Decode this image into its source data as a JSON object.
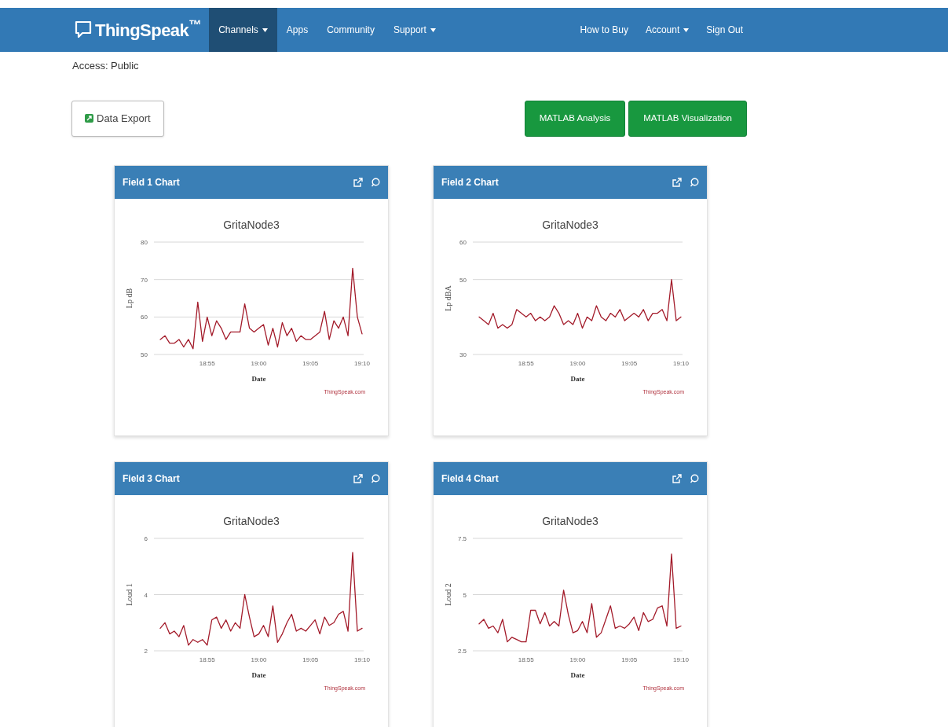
{
  "navbar": {
    "logo": "ThingSpeak$^{™}$",
    "left_items": [
      {
        "label": "Channels",
        "dropdown": true,
        "selected": true
      },
      {
        "label": "Apps",
        "dropdown": false,
        "selected": false
      },
      {
        "label": "Community",
        "dropdown": false,
        "selected": false
      },
      {
        "label": "Support",
        "dropdown": true,
        "selected": false
      }
    ],
    "right_items": [
      {
        "label": "How to Buy",
        "dropdown": false
      },
      {
        "label": "Account",
        "dropdown": true
      },
      {
        "label": "Sign Out",
        "dropdown": false
      }
    ]
  },
  "access": "Access: Public",
  "export_button": "Data Export",
  "matlab_buttons": [
    "MATLAB Analysis",
    "MATLAB Visualization"
  ],
  "charts": [
    {
      "header": "Field 1 Chart",
      "credit": "ThingSpeak.com",
      "chart_data": {
        "type": "line",
        "title": "GritaNode3",
        "xlabel": "Date",
        "ylabel": "Lp dB",
        "ylim": [
          50,
          80
        ],
        "yticks": [
          50,
          60,
          70,
          80
        ],
        "categories": [
          null,
          null,
          null,
          null,
          null,
          null,
          null,
          null,
          null,
          null,
          "18:55",
          null,
          null,
          null,
          null,
          null,
          null,
          null,
          null,
          null,
          null,
          "19:00",
          null,
          null,
          null,
          null,
          null,
          null,
          null,
          null,
          null,
          null,
          "19:05",
          null,
          null,
          null,
          null,
          null,
          null,
          null,
          null,
          null,
          null,
          "19:10"
        ],
        "series": [
          {
            "color": "#a31b2a",
            "values": [
              54,
              55,
              53,
              53,
              54,
              52,
              54,
              51.5,
              64,
              53.5,
              60,
              55,
              59,
              57,
              54,
              56,
              56,
              56,
              63.5,
              57,
              56,
              57,
              58,
              52.5,
              57,
              52,
              58.5,
              55,
              57,
              53.5,
              55,
              54,
              54,
              55,
              56,
              61.5,
              54,
              59,
              57,
              60,
              55,
              73,
              60,
              55.5
            ]
          }
        ]
      }
    },
    {
      "header": "Field 2 Chart",
      "credit": "ThingSpeak.com",
      "chart_data": {
        "type": "line",
        "title": "GritaNode3",
        "xlabel": "Date",
        "ylabel": "Lp dBA",
        "ylim": [
          30,
          60
        ],
        "yticks": [
          30,
          50,
          60
        ],
        "categories": [
          null,
          null,
          null,
          null,
          null,
          null,
          null,
          null,
          null,
          null,
          "18:55",
          null,
          null,
          null,
          null,
          null,
          null,
          null,
          null,
          null,
          null,
          "19:00",
          null,
          null,
          null,
          null,
          null,
          null,
          null,
          null,
          null,
          null,
          "19:05",
          null,
          null,
          null,
          null,
          null,
          null,
          null,
          null,
          null,
          null,
          "19:10"
        ],
        "series": [
          {
            "color": "#a31b2a",
            "values": [
              40,
              39,
              38,
              41,
              37,
              38,
              37,
              38,
              42,
              41,
              40,
              41,
              39,
              40,
              39,
              40,
              43,
              41,
              38,
              39,
              38,
              41,
              37,
              40,
              39,
              43,
              40,
              39,
              41,
              40,
              42,
              39,
              40,
              41,
              40,
              42,
              39,
              41,
              41,
              42,
              39,
              50,
              39,
              40
            ]
          }
        ]
      }
    },
    {
      "header": "Field 3 Chart",
      "credit": "ThingSpeak.com",
      "chart_data": {
        "type": "line",
        "title": "GritaNode3",
        "xlabel": "Date",
        "ylabel": "Loud 1",
        "ylim": [
          2,
          6
        ],
        "yticks": [
          2,
          4,
          6
        ],
        "categories": [
          null,
          null,
          null,
          null,
          null,
          null,
          null,
          null,
          null,
          null,
          "18:55",
          null,
          null,
          null,
          null,
          null,
          null,
          null,
          null,
          null,
          null,
          "19:00",
          null,
          null,
          null,
          null,
          null,
          null,
          null,
          null,
          null,
          null,
          "19:05",
          null,
          null,
          null,
          null,
          null,
          null,
          null,
          null,
          null,
          null,
          "19:10"
        ],
        "series": [
          {
            "color": "#a31b2a",
            "values": [
              2.8,
              3.0,
              2.6,
              2.7,
              2.5,
              2.9,
              2.2,
              2.4,
              2.3,
              2.4,
              2.2,
              3.1,
              3.2,
              2.8,
              3.1,
              2.7,
              3.0,
              2.8,
              4.0,
              3.2,
              2.5,
              2.6,
              2.9,
              2.5,
              3.6,
              2.3,
              2.6,
              3.0,
              3.3,
              2.7,
              2.8,
              2.7,
              2.9,
              3.1,
              2.6,
              3.2,
              2.9,
              3.0,
              3.3,
              3.4,
              2.7,
              5.5,
              2.7,
              2.8
            ]
          }
        ]
      }
    },
    {
      "header": "Field 4 Chart",
      "credit": "ThingSpeak.com",
      "chart_data": {
        "type": "line",
        "title": "GritaNode3",
        "xlabel": "Date",
        "ylabel": "Loud 2",
        "ylim": [
          2.5,
          7.5
        ],
        "yticks": [
          2.5,
          5,
          7.5
        ],
        "categories": [
          null,
          null,
          null,
          null,
          null,
          null,
          null,
          null,
          null,
          null,
          "18:55",
          null,
          null,
          null,
          null,
          null,
          null,
          null,
          null,
          null,
          null,
          "19:00",
          null,
          null,
          null,
          null,
          null,
          null,
          null,
          null,
          null,
          null,
          "19:05",
          null,
          null,
          null,
          null,
          null,
          null,
          null,
          null,
          null,
          null,
          "19:10"
        ],
        "series": [
          {
            "color": "#a31b2a",
            "values": [
              3.7,
              3.9,
              3.5,
              3.6,
              3.3,
              3.9,
              2.9,
              3.1,
              3.0,
              2.9,
              2.9,
              4.3,
              4.3,
              3.7,
              4.2,
              3.6,
              3.8,
              3.6,
              5.2,
              4.1,
              3.3,
              3.4,
              3.8,
              3.3,
              4.6,
              3.1,
              3.3,
              3.9,
              4.5,
              3.5,
              3.6,
              3.5,
              3.7,
              4.0,
              3.4,
              4.2,
              3.8,
              3.9,
              4.4,
              4.5,
              3.6,
              6.8,
              3.5,
              3.6
            ]
          }
        ]
      }
    }
  ]
}
